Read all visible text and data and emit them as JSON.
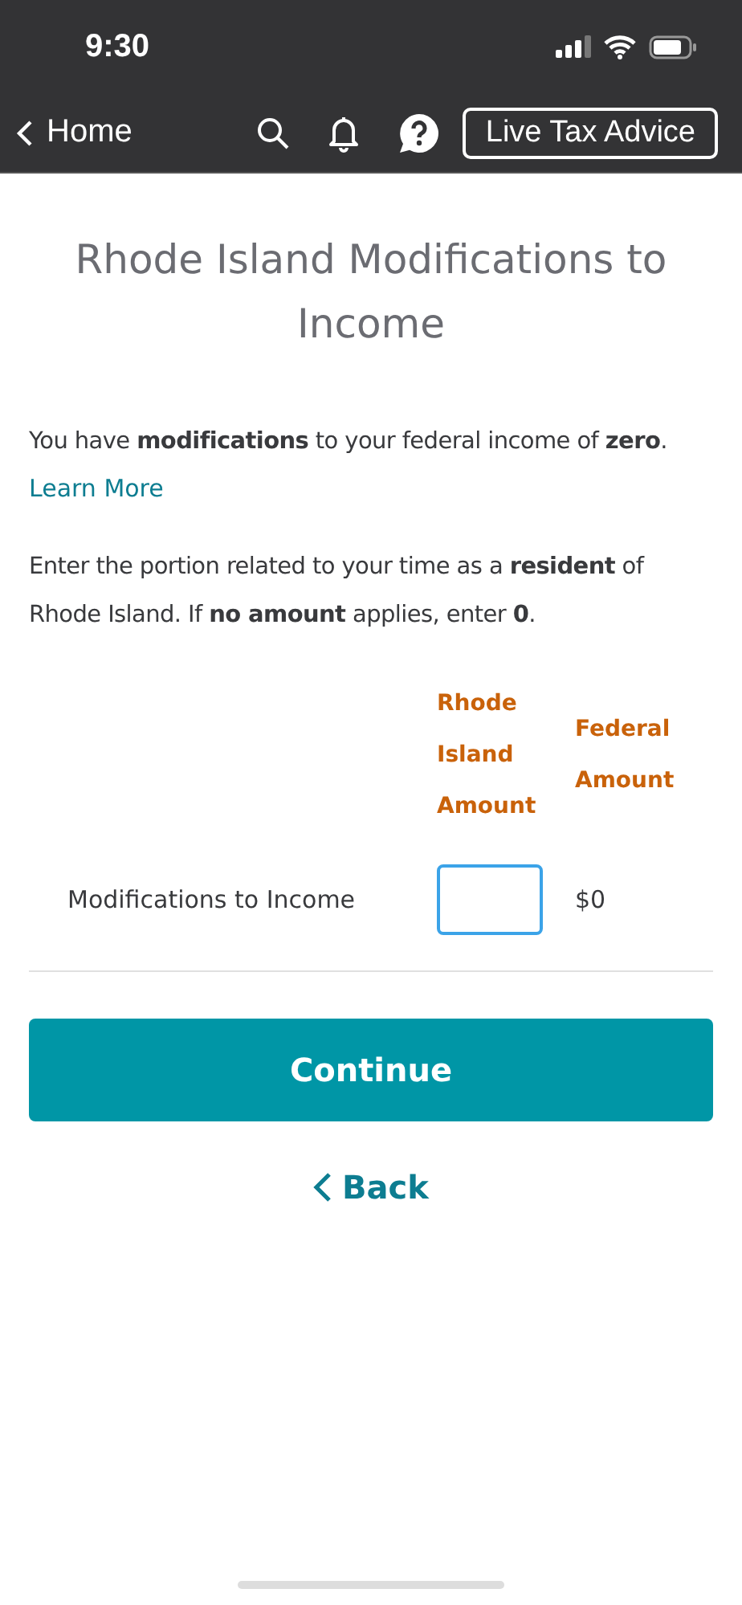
{
  "status_bar": {
    "time": "9:30"
  },
  "nav": {
    "back_label": "Home",
    "advice_button": "Live Tax Advice"
  },
  "title": "Rhode Island Modifications to Income",
  "intro": "You have **modifications** to your federal income of **zero**.",
  "learn_more": "Learn More",
  "instruction": "Enter the portion related to your time as a **resident** of Rhode Island. If **no amount** applies, enter **0**.",
  "table": {
    "columns": [
      "Rhode Island Amount",
      "Federal Amount"
    ],
    "rows": [
      {
        "label": "Modifications to Income",
        "focused": true,
        "federal": "$0"
      }
    ]
  },
  "continue_button": "Continue",
  "back_link": "Back"
}
